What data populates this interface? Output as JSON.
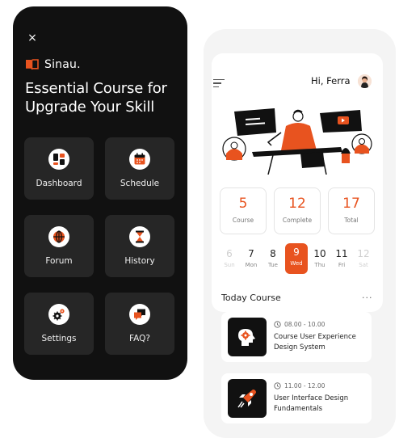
{
  "menu": {
    "close_label": "×",
    "brand_name": "Sinau.",
    "title": "Essential Course for Upgrade Your Skill",
    "items": [
      {
        "label": "Dashboard",
        "icon": "dashboard-icon"
      },
      {
        "label": "Schedule",
        "icon": "calendar-icon"
      },
      {
        "label": "Forum",
        "icon": "globe-icon"
      },
      {
        "label": "History",
        "icon": "hourglass-icon"
      },
      {
        "label": "Settings",
        "icon": "gear-icon"
      },
      {
        "label": "FAQ?",
        "icon": "chat-icon"
      }
    ]
  },
  "app": {
    "greeting": "Hi, Ferra",
    "stats": [
      {
        "value": "5",
        "label": "Course"
      },
      {
        "value": "12",
        "label": "Complete"
      },
      {
        "value": "17",
        "label": "Total"
      }
    ],
    "days": [
      {
        "num": "6",
        "name": "Sun"
      },
      {
        "num": "7",
        "name": "Mon"
      },
      {
        "num": "8",
        "name": "Tue"
      },
      {
        "num": "9",
        "name": "Wed"
      },
      {
        "num": "10",
        "name": "Thu"
      },
      {
        "num": "11",
        "name": "Fri"
      },
      {
        "num": "12",
        "name": "Sat"
      }
    ],
    "today_title": "Today Course",
    "more_label": "···",
    "courses": [
      {
        "time": "08.00 - 10.00",
        "title": "Course User Experience Design System",
        "icon": "brain-gear-icon"
      },
      {
        "time": "11.00 - 12.00",
        "title": "User Interface Design Fundamentals",
        "icon": "rocket-icon"
      }
    ]
  },
  "colors": {
    "accent": "#e8531f",
    "dark": "#111111",
    "tile": "#262626"
  }
}
